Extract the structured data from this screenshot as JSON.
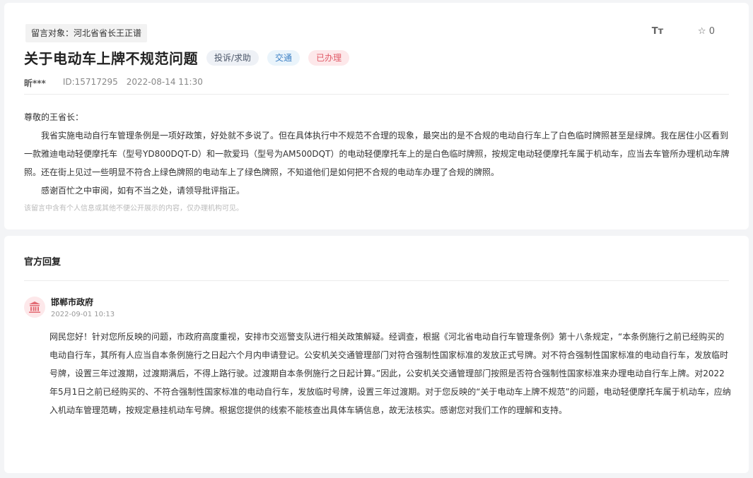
{
  "message": {
    "target_label": "留言对象：河北省省长王正谱",
    "tools": {
      "font_icon_text": "Tт",
      "star_count": "0"
    },
    "title": "关于电动车上牌不规范问题",
    "badges": {
      "type": "投诉/求助",
      "category": "交通",
      "status": "已办理"
    },
    "author": "昕***",
    "id_text": "ID:15717295",
    "datetime": "2022-08-14 11:30",
    "greeting": "尊敬的王省长：",
    "paragraphs": [
      "我省实施电动自行车管理条例是一项好政策，好处就不多说了。但在具体执行中不规范不合理的现象，最突出的是不合规的电动自行车上了白色临时牌照甚至是绿牌。我在居住小区看到一款雅迪电动轻便摩托车（型号YD800DQT-D）和一款爱玛（型号为AM500DQT）的电动轻便摩托车上的是白色临时牌照，按规定电动轻便摩托车属于机动车，应当去车管所办理机动车牌照。还在街上见过一些明显不符合上绿色牌照的电动车上了绿色牌照，不知道他们是如何把不合规的电动车办理了合规的牌照。",
      "感谢百忙之中审阅，如有不当之处，请领导批评指正。"
    ],
    "notice": "该留言中含有个人信息或其他不便公开展示的内容，仅办理机构可见。"
  },
  "reply": {
    "section_title": "官方回复",
    "org_name": "邯郸市政府",
    "date": "2022-09-01 10:13",
    "text": "网民您好！针对您所反映的问题，市政府高度重视，安排市交巡警支队进行相关政策解疑。经调查，根据《河北省电动自行车管理条例》第十八条规定，“本条例施行之前已经购买的电动自行车，其所有人应当自本条例施行之日起六个月内申请登记。公安机关交通管理部门对符合强制性国家标准的发放正式号牌。对不符合强制性国家标准的电动自行车，发放临时号牌，设置三年过渡期，过渡期满后，不得上路行驶。过渡期自本条例施行之日起计算。”因此，公安机关交通管理部门按照是否符合强制性国家标准来办理电动自行车上牌。对2022年5月1日之前已经购买的、不符合强制性国家标准的电动自行车，发放临时号牌，设置三年过渡期。对于您反映的“关于电动车上牌不规范”的问题，电动轻便摩托车属于机动车，应纳入机动车管理范畴，按规定悬挂机动车号牌。根据您提供的线索不能核查出具体车辆信息，故无法核实。感谢您对我们工作的理解和支持。"
  },
  "icons": {
    "font": "font-size-icon",
    "star": "star-icon",
    "gov": "government-building-icon"
  },
  "colors": {
    "status_red": "#e05a67",
    "category_blue": "#3b7fc4",
    "gov_icon": "#e36b74"
  }
}
